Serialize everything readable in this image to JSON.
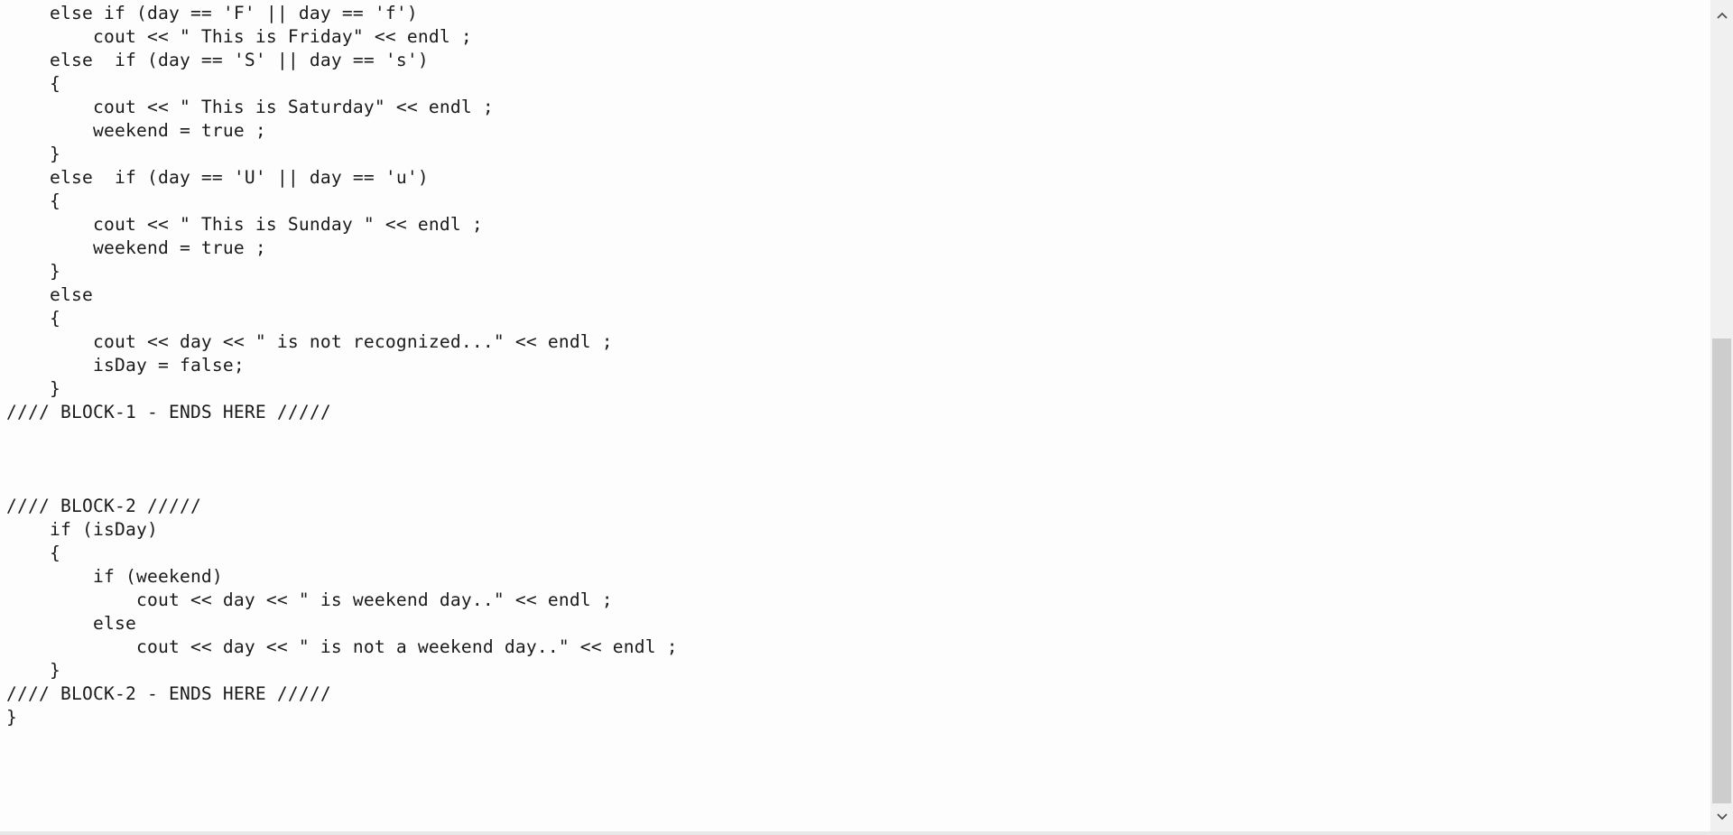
{
  "editor": {
    "lines": [
      "    else if (day == 'F' || day == 'f')",
      "        cout << \" This is Friday\" << endl ;",
      "    else  if (day == 'S' || day == 's')",
      "    {",
      "        cout << \" This is Saturday\" << endl ;",
      "        weekend = true ;",
      "    }",
      "    else  if (day == 'U' || day == 'u')",
      "    {",
      "        cout << \" This is Sunday \" << endl ;",
      "        weekend = true ;",
      "    }",
      "    else",
      "    {",
      "        cout << day << \" is not recognized...\" << endl ;",
      "        isDay = false;",
      "    }",
      "//// BLOCK-1 - ENDS HERE /////",
      "",
      "",
      "",
      "//// BLOCK-2 /////",
      "    if (isDay)",
      "    {",
      "        if (weekend)",
      "            cout << day << \" is weekend day..\" << endl ;",
      "        else",
      "            cout << day << \" is not a weekend day..\" << endl ;",
      "    }",
      "//// BLOCK-2 - ENDS HERE /////",
      "}"
    ]
  },
  "scrollbar": {
    "up_icon": "chevron-up-icon",
    "down_icon": "chevron-down-icon",
    "scroll_position_fraction": 0.45,
    "visible_fraction": 0.6
  }
}
